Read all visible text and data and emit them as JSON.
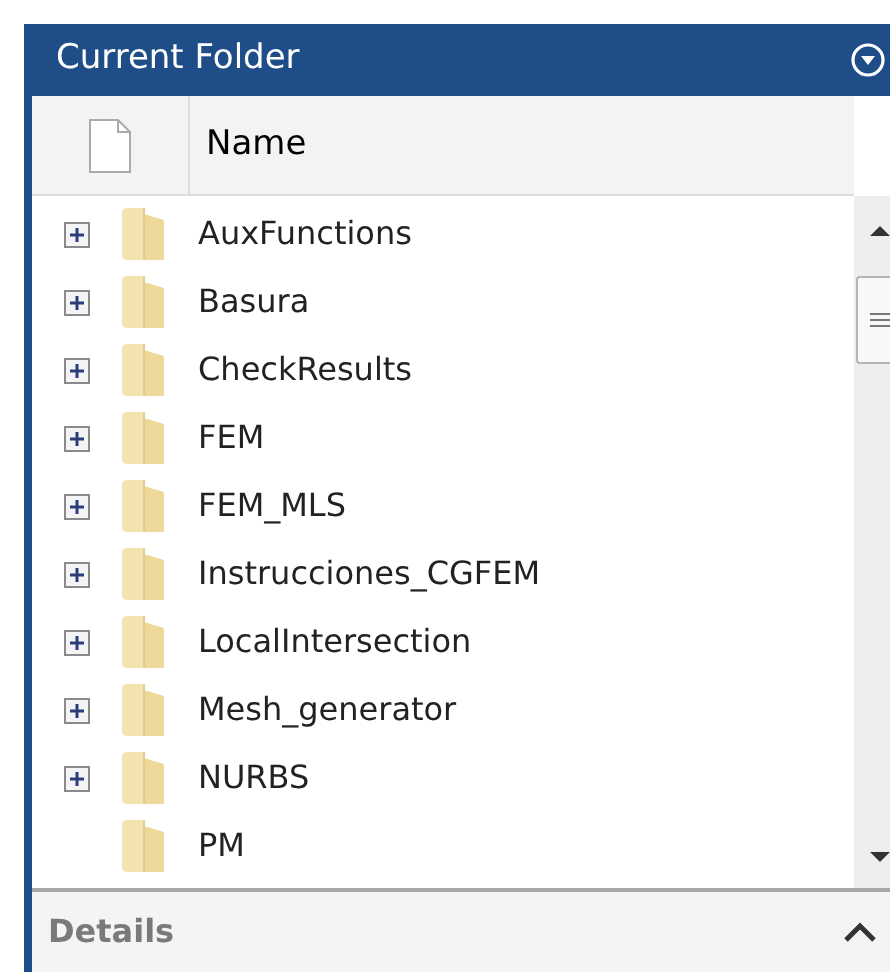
{
  "panel": {
    "title": "Current Folder"
  },
  "columns": [
    {
      "label": "Name"
    }
  ],
  "rows": [
    {
      "name": "AuxFunctions",
      "expandable": true
    },
    {
      "name": "Basura",
      "expandable": true
    },
    {
      "name": "CheckResults",
      "expandable": true
    },
    {
      "name": "FEM",
      "expandable": true
    },
    {
      "name": "FEM_MLS",
      "expandable": true
    },
    {
      "name": "Instrucciones_CGFEM",
      "expandable": true
    },
    {
      "name": "LocalIntersection",
      "expandable": true
    },
    {
      "name": "Mesh_generator",
      "expandable": true
    },
    {
      "name": "NURBS",
      "expandable": true
    },
    {
      "name": "PM",
      "expandable": false
    }
  ],
  "details": {
    "label": "Details"
  }
}
